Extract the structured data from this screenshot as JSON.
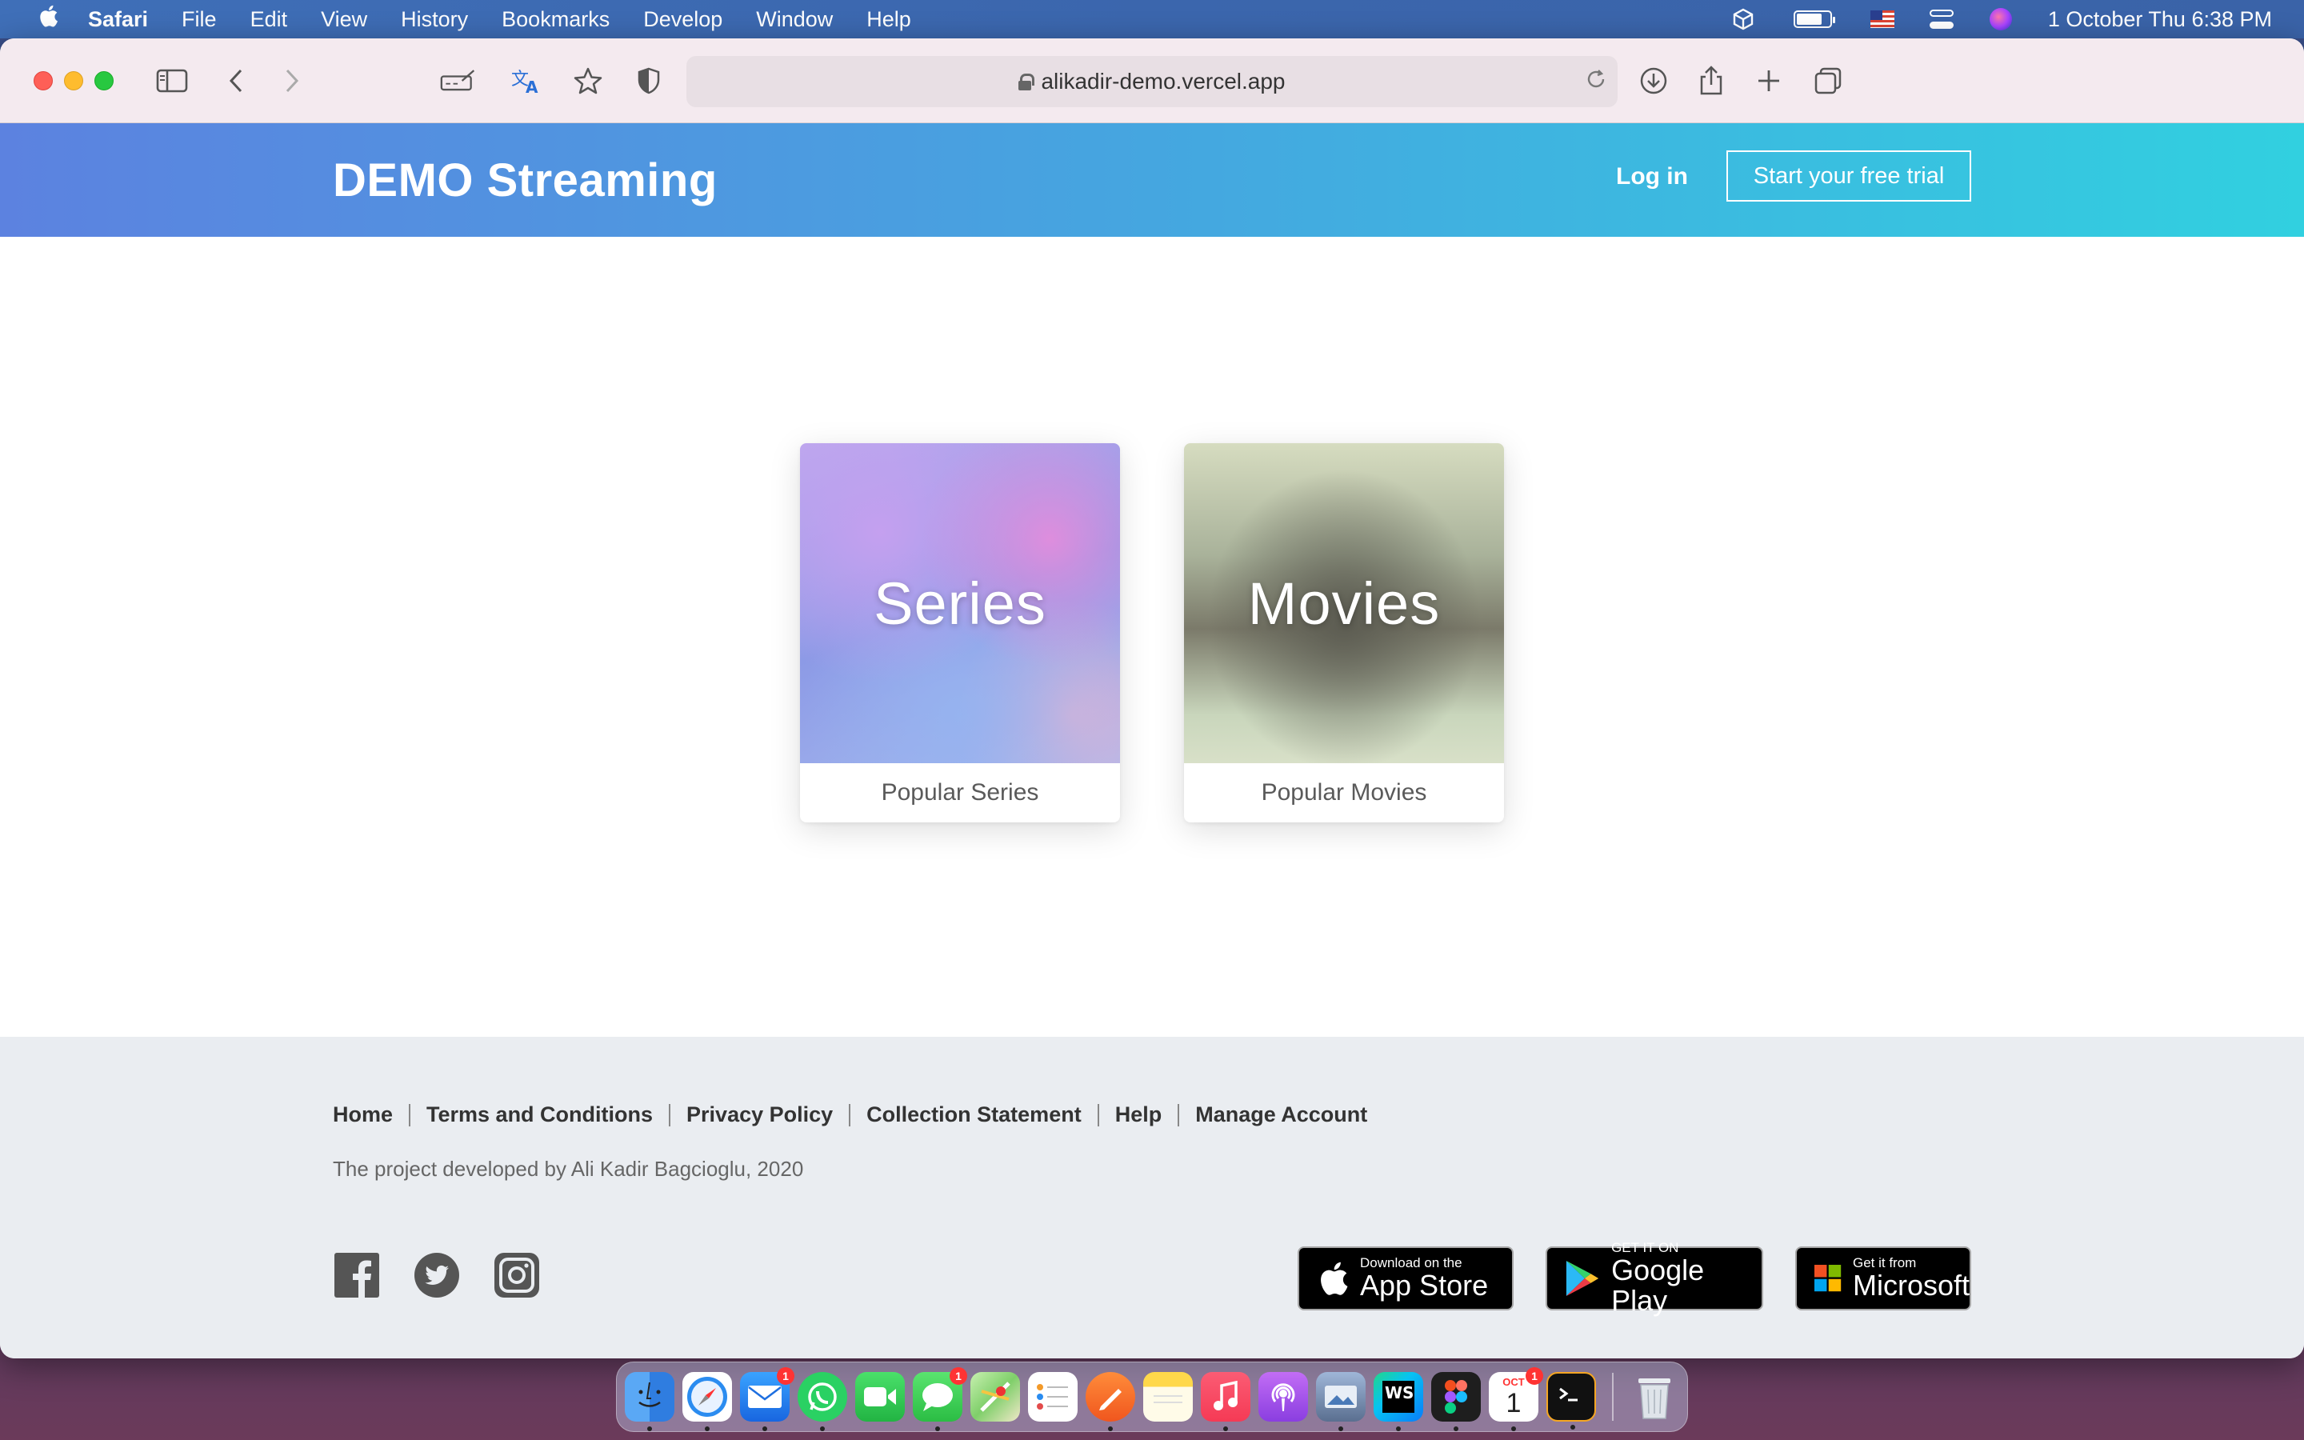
{
  "menubar": {
    "app_name": "Safari",
    "items": [
      "File",
      "Edit",
      "View",
      "History",
      "Bookmarks",
      "Develop",
      "Window",
      "Help"
    ],
    "clock": "1 October Thu  6:38 PM"
  },
  "browser": {
    "url": "alikadir-demo.vercel.app"
  },
  "site": {
    "brand": "DEMO Streaming",
    "login_label": "Log in",
    "trial_label": "Start your free trial",
    "cards": [
      {
        "title": "Series",
        "caption": "Popular Series"
      },
      {
        "title": "Movies",
        "caption": "Popular Movies"
      }
    ],
    "footer": {
      "links": [
        "Home",
        "Terms and Conditions",
        "Privacy Policy",
        "Collection Statement",
        "Help",
        "Manage Account"
      ],
      "credit": "The project developed by Ali Kadir Bagcioglu, 2020",
      "stores": [
        {
          "small": "Download on the",
          "big": "App Store"
        },
        {
          "small": "GET IT ON",
          "big": "Google Play"
        },
        {
          "small": "Get it from",
          "big": "Microsoft"
        }
      ]
    }
  },
  "dock": {
    "mail_badge": "1",
    "messages_badge": "1",
    "calendar_month": "OCT",
    "calendar_day": "1",
    "calendar_badge": "1",
    "webstorm_label": "WS"
  }
}
